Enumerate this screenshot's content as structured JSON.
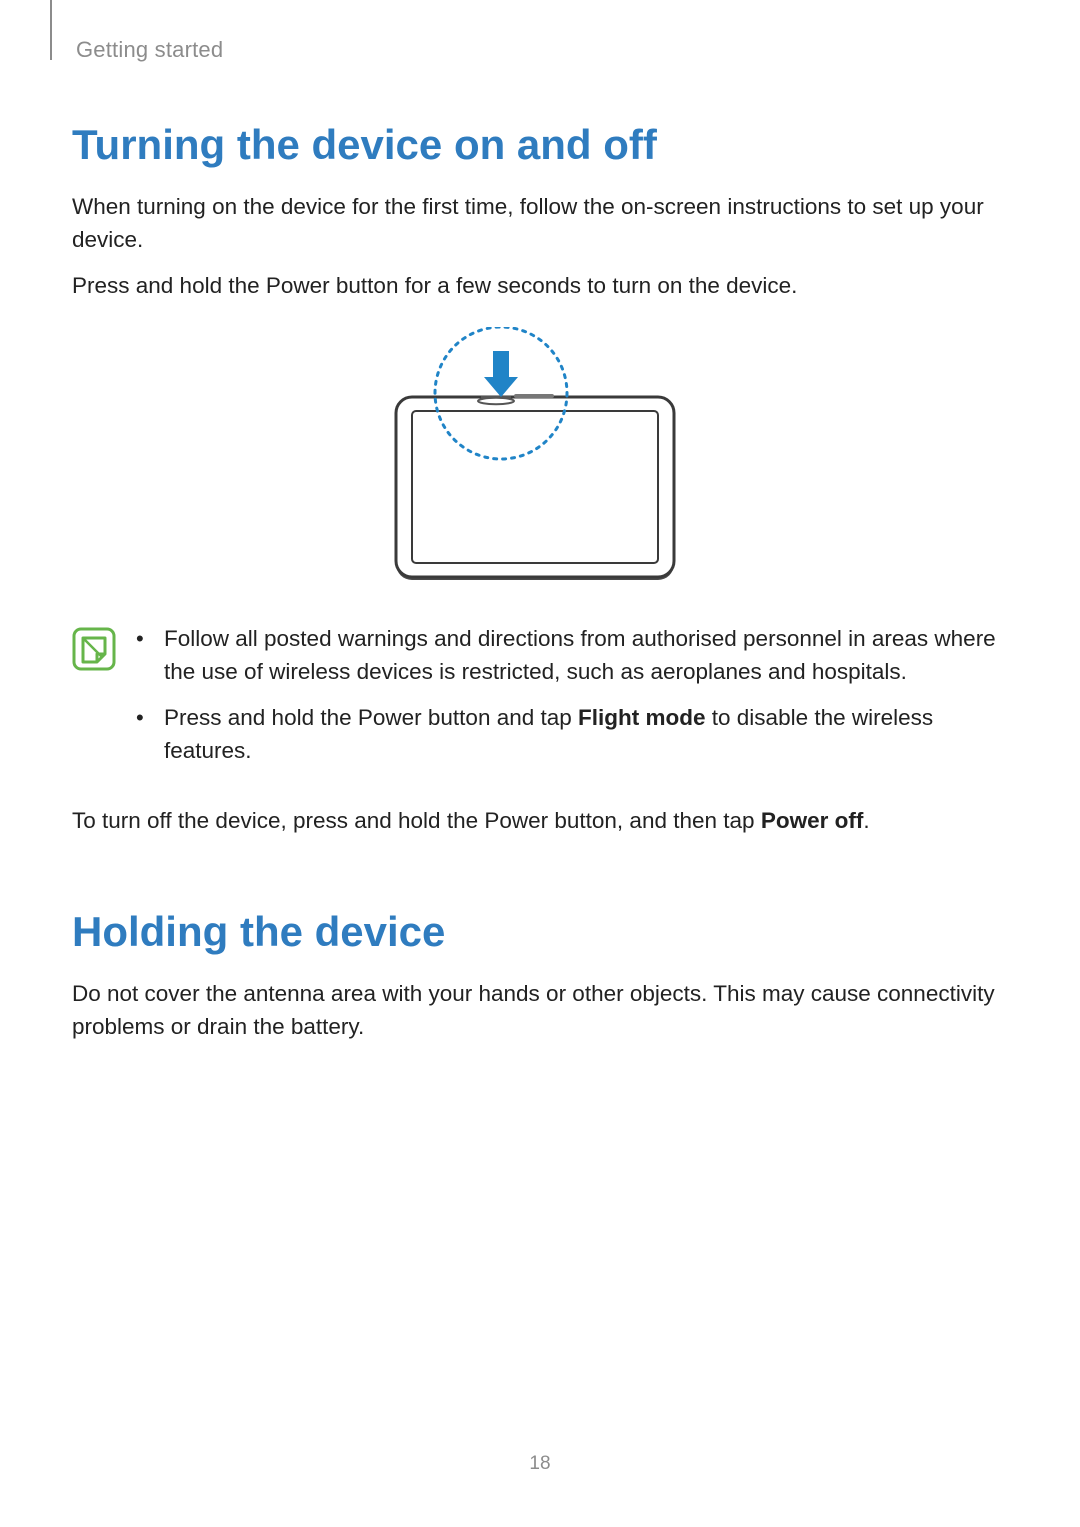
{
  "breadcrumb": "Getting started",
  "section1": {
    "title": "Turning the device on and off",
    "p1": "When turning on the device for the first time, follow the on-screen instructions to set up your device.",
    "p2": "Press and hold the Power button for a few seconds to turn on the device.",
    "note1": "Follow all posted warnings and directions from authorised personnel in areas where the use of wireless devices is restricted, such as aeroplanes and hospitals.",
    "note2_pre": "Press and hold the Power button and tap ",
    "note2_b": "Flight mode",
    "note2_post": " to disable the wireless features.",
    "p3_pre": "To turn off the device, press and hold the Power button, and then tap ",
    "p3_b": "Power off",
    "p3_post": "."
  },
  "section2": {
    "title": "Holding the device",
    "p1": "Do not cover the antenna area with your hands or other objects. This may cause connectivity problems or drain the battery."
  },
  "page_number": "18",
  "bullet": "•",
  "colors": {
    "heading": "#2f7cbf",
    "muted": "#8c8c8c",
    "accent": "#2084c7",
    "note_green": "#66b54a"
  }
}
